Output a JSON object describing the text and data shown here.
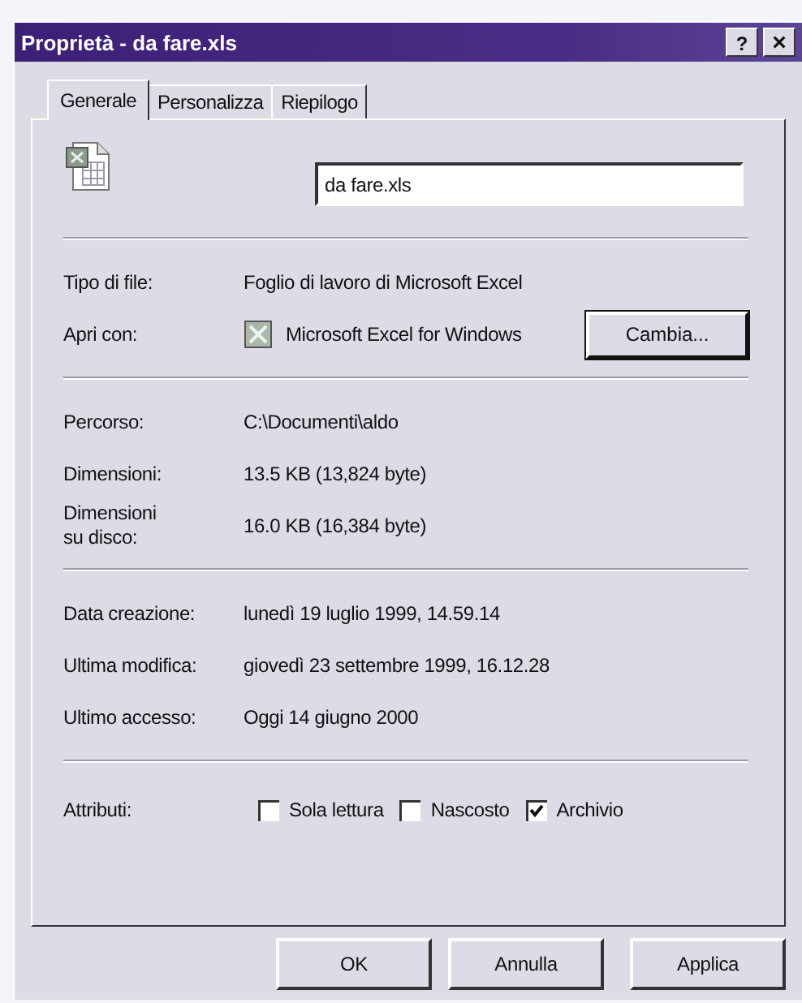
{
  "window": {
    "title": "Proprietà - da fare.xls",
    "controls": [
      {
        "kind": "help",
        "label": "?"
      },
      {
        "kind": "close",
        "label": "×"
      }
    ]
  },
  "tabs": [
    {
      "label": "Generale",
      "selected": true
    },
    {
      "label": "Personalizza",
      "selected": false
    },
    {
      "label": "Riepilogo",
      "selected": false
    }
  ],
  "file_name": {
    "value": "da fare.xls"
  },
  "sections": [
    [
      {
        "kind": "text",
        "label": "Tipo di file:",
        "value": "Foglio di lavoro di Microsoft Excel"
      },
      {
        "kind": "app",
        "label": "Apri con:",
        "value": "Microsoft Excel for Windows",
        "button": "Cambia..."
      }
    ],
    [
      {
        "kind": "text",
        "label": "Percorso:",
        "value": "C:\\Documenti\\aldo"
      },
      {
        "kind": "text",
        "label": "Dimensioni:",
        "value": "13.5 KB (13,824 byte)"
      },
      {
        "kind": "text",
        "label": "Dimensioni su disco:",
        "value": "16.0 KB (16,384 byte)"
      }
    ],
    [
      {
        "kind": "text",
        "label": "Data creazione:",
        "value": "lunedì 19 luglio 1999, 14.59.14"
      },
      {
        "kind": "text",
        "label": "Ultima modifica:",
        "value": "giovedì 23 settembre 1999, 16.12.28"
      },
      {
        "kind": "text",
        "label": "Ultimo accesso:",
        "value": "Oggi 14 giugno 2000"
      }
    ]
  ],
  "attributes": {
    "label": "Attributi:",
    "options": [
      {
        "label": "Sola lettura",
        "checked": false
      },
      {
        "label": "Nascosto",
        "checked": false
      },
      {
        "label": "Archivio",
        "checked": true
      }
    ]
  },
  "buttons": [
    "OK",
    "Annulla",
    "Applica"
  ]
}
